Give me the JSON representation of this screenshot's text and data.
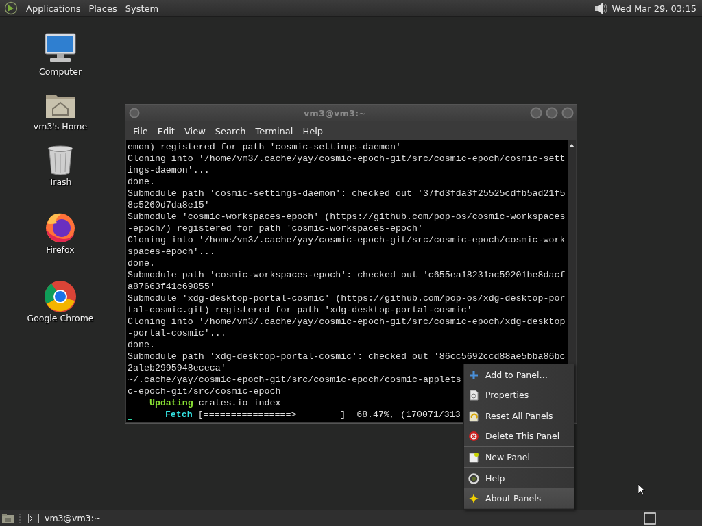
{
  "top_panel": {
    "menus": [
      "Applications",
      "Places",
      "System"
    ],
    "clock": "Wed Mar 29, 03:15"
  },
  "desktop_icons": [
    {
      "kind": "computer",
      "label": "Computer"
    },
    {
      "kind": "home",
      "label": "vm3's Home"
    },
    {
      "kind": "trash",
      "label": "Trash"
    },
    {
      "kind": "firefox",
      "label": "Firefox"
    },
    {
      "kind": "chrome",
      "label": "Google Chrome"
    }
  ],
  "terminal": {
    "title": "vm3@vm3:~",
    "menus": [
      "File",
      "Edit",
      "View",
      "Search",
      "Terminal",
      "Help"
    ],
    "lines": [
      {
        "text": "emon) registered for path 'cosmic-settings-daemon'"
      },
      {
        "text": "Cloning into '/home/vm3/.cache/yay/cosmic-epoch-git/src/cosmic-epoch/cosmic-sett"
      },
      {
        "text": "ings-daemon'..."
      },
      {
        "text": "done."
      },
      {
        "text": "Submodule path 'cosmic-settings-daemon': checked out '37fd3fda3f25525cdfb5ad21f5"
      },
      {
        "text": "8c5260d7da8e15'"
      },
      {
        "text": "Submodule 'cosmic-workspaces-epoch' (https://github.com/pop-os/cosmic-workspaces"
      },
      {
        "text": "-epoch/) registered for path 'cosmic-workspaces-epoch'"
      },
      {
        "text": "Cloning into '/home/vm3/.cache/yay/cosmic-epoch-git/src/cosmic-epoch/cosmic-work"
      },
      {
        "text": "spaces-epoch'..."
      },
      {
        "text": "done."
      },
      {
        "text": "Submodule path 'cosmic-workspaces-epoch': checked out 'c655ea18231ac59201be8dacf"
      },
      {
        "text": "a87663f41c69855'"
      },
      {
        "text": "Submodule 'xdg-desktop-portal-cosmic' (https://github.com/pop-os/xdg-desktop-por"
      },
      {
        "text": "tal-cosmic.git) registered for path 'xdg-desktop-portal-cosmic'"
      },
      {
        "text": "Cloning into '/home/vm3/.cache/yay/cosmic-epoch-git/src/cosmic-epoch/xdg-desktop"
      },
      {
        "text": "-portal-cosmic'..."
      },
      {
        "text": "done."
      },
      {
        "text": "Submodule path 'xdg-desktop-portal-cosmic': checked out '86cc5692ccd88ae5bba86bc"
      },
      {
        "text": "2aleb2995948ececa'"
      },
      {
        "text": "~/.cache/yay/cosmic-epoch-git/src/cosmic-epoch/cosmic-applets"
      },
      {
        "text": "c-epoch-git/src/cosmic-epoch"
      },
      {
        "keyword": "    Updating",
        "color": "#8ae234",
        "text": " crates.io index",
        "cursor": false
      },
      {
        "keyword": "      Fetch",
        "color": "#34e2e2",
        "text": " [================>        ]  68.47%, (170071/313",
        "cursor": true
      }
    ]
  },
  "context_menu": {
    "items": [
      {
        "kind": "add",
        "label": "Add to Panel…",
        "selected": false,
        "separator_after": false
      },
      {
        "kind": "properties",
        "label": "Properties",
        "selected": false,
        "separator_after": true
      },
      {
        "kind": "reset",
        "label": "Reset All Panels",
        "selected": false,
        "separator_after": false
      },
      {
        "kind": "delete",
        "label": "Delete This Panel",
        "selected": false,
        "separator_after": true
      },
      {
        "kind": "new",
        "label": "New Panel",
        "selected": false,
        "separator_after": true
      },
      {
        "kind": "help",
        "label": "Help",
        "selected": false,
        "separator_after": false
      },
      {
        "kind": "about",
        "label": "About Panels",
        "selected": true,
        "separator_after": false
      }
    ]
  },
  "bottom_panel": {
    "tasks": [
      {
        "label": "vm3@vm3:~",
        "selected": false
      }
    ]
  }
}
